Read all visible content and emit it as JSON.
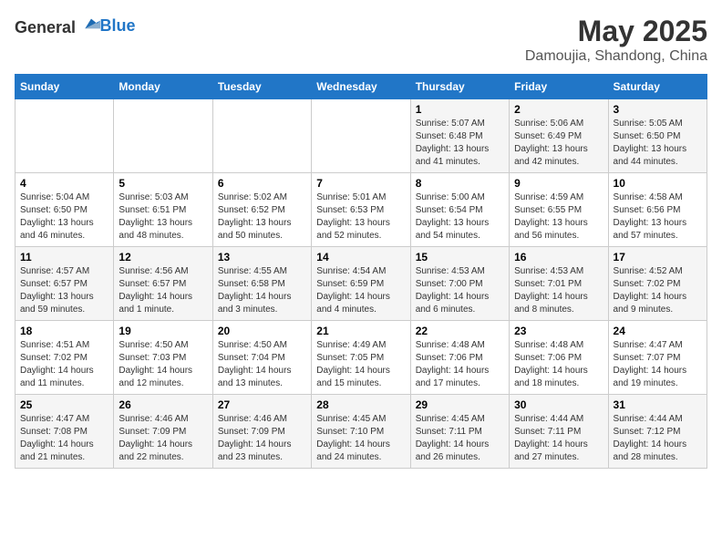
{
  "header": {
    "logo_general": "General",
    "logo_blue": "Blue",
    "month": "May 2025",
    "location": "Damoujia, Shandong, China"
  },
  "days_of_week": [
    "Sunday",
    "Monday",
    "Tuesday",
    "Wednesday",
    "Thursday",
    "Friday",
    "Saturday"
  ],
  "weeks": [
    [
      {
        "day": "",
        "info": ""
      },
      {
        "day": "",
        "info": ""
      },
      {
        "day": "",
        "info": ""
      },
      {
        "day": "",
        "info": ""
      },
      {
        "day": "1",
        "info": "Sunrise: 5:07 AM\nSunset: 6:48 PM\nDaylight: 13 hours\nand 41 minutes."
      },
      {
        "day": "2",
        "info": "Sunrise: 5:06 AM\nSunset: 6:49 PM\nDaylight: 13 hours\nand 42 minutes."
      },
      {
        "day": "3",
        "info": "Sunrise: 5:05 AM\nSunset: 6:50 PM\nDaylight: 13 hours\nand 44 minutes."
      }
    ],
    [
      {
        "day": "4",
        "info": "Sunrise: 5:04 AM\nSunset: 6:50 PM\nDaylight: 13 hours\nand 46 minutes."
      },
      {
        "day": "5",
        "info": "Sunrise: 5:03 AM\nSunset: 6:51 PM\nDaylight: 13 hours\nand 48 minutes."
      },
      {
        "day": "6",
        "info": "Sunrise: 5:02 AM\nSunset: 6:52 PM\nDaylight: 13 hours\nand 50 minutes."
      },
      {
        "day": "7",
        "info": "Sunrise: 5:01 AM\nSunset: 6:53 PM\nDaylight: 13 hours\nand 52 minutes."
      },
      {
        "day": "8",
        "info": "Sunrise: 5:00 AM\nSunset: 6:54 PM\nDaylight: 13 hours\nand 54 minutes."
      },
      {
        "day": "9",
        "info": "Sunrise: 4:59 AM\nSunset: 6:55 PM\nDaylight: 13 hours\nand 56 minutes."
      },
      {
        "day": "10",
        "info": "Sunrise: 4:58 AM\nSunset: 6:56 PM\nDaylight: 13 hours\nand 57 minutes."
      }
    ],
    [
      {
        "day": "11",
        "info": "Sunrise: 4:57 AM\nSunset: 6:57 PM\nDaylight: 13 hours\nand 59 minutes."
      },
      {
        "day": "12",
        "info": "Sunrise: 4:56 AM\nSunset: 6:57 PM\nDaylight: 14 hours\nand 1 minute."
      },
      {
        "day": "13",
        "info": "Sunrise: 4:55 AM\nSunset: 6:58 PM\nDaylight: 14 hours\nand 3 minutes."
      },
      {
        "day": "14",
        "info": "Sunrise: 4:54 AM\nSunset: 6:59 PM\nDaylight: 14 hours\nand 4 minutes."
      },
      {
        "day": "15",
        "info": "Sunrise: 4:53 AM\nSunset: 7:00 PM\nDaylight: 14 hours\nand 6 minutes."
      },
      {
        "day": "16",
        "info": "Sunrise: 4:53 AM\nSunset: 7:01 PM\nDaylight: 14 hours\nand 8 minutes."
      },
      {
        "day": "17",
        "info": "Sunrise: 4:52 AM\nSunset: 7:02 PM\nDaylight: 14 hours\nand 9 minutes."
      }
    ],
    [
      {
        "day": "18",
        "info": "Sunrise: 4:51 AM\nSunset: 7:02 PM\nDaylight: 14 hours\nand 11 minutes."
      },
      {
        "day": "19",
        "info": "Sunrise: 4:50 AM\nSunset: 7:03 PM\nDaylight: 14 hours\nand 12 minutes."
      },
      {
        "day": "20",
        "info": "Sunrise: 4:50 AM\nSunset: 7:04 PM\nDaylight: 14 hours\nand 13 minutes."
      },
      {
        "day": "21",
        "info": "Sunrise: 4:49 AM\nSunset: 7:05 PM\nDaylight: 14 hours\nand 15 minutes."
      },
      {
        "day": "22",
        "info": "Sunrise: 4:48 AM\nSunset: 7:06 PM\nDaylight: 14 hours\nand 17 minutes."
      },
      {
        "day": "23",
        "info": "Sunrise: 4:48 AM\nSunset: 7:06 PM\nDaylight: 14 hours\nand 18 minutes."
      },
      {
        "day": "24",
        "info": "Sunrise: 4:47 AM\nSunset: 7:07 PM\nDaylight: 14 hours\nand 19 minutes."
      }
    ],
    [
      {
        "day": "25",
        "info": "Sunrise: 4:47 AM\nSunset: 7:08 PM\nDaylight: 14 hours\nand 21 minutes."
      },
      {
        "day": "26",
        "info": "Sunrise: 4:46 AM\nSunset: 7:09 PM\nDaylight: 14 hours\nand 22 minutes."
      },
      {
        "day": "27",
        "info": "Sunrise: 4:46 AM\nSunset: 7:09 PM\nDaylight: 14 hours\nand 23 minutes."
      },
      {
        "day": "28",
        "info": "Sunrise: 4:45 AM\nSunset: 7:10 PM\nDaylight: 14 hours\nand 24 minutes."
      },
      {
        "day": "29",
        "info": "Sunrise: 4:45 AM\nSunset: 7:11 PM\nDaylight: 14 hours\nand 26 minutes."
      },
      {
        "day": "30",
        "info": "Sunrise: 4:44 AM\nSunset: 7:11 PM\nDaylight: 14 hours\nand 27 minutes."
      },
      {
        "day": "31",
        "info": "Sunrise: 4:44 AM\nSunset: 7:12 PM\nDaylight: 14 hours\nand 28 minutes."
      }
    ]
  ]
}
